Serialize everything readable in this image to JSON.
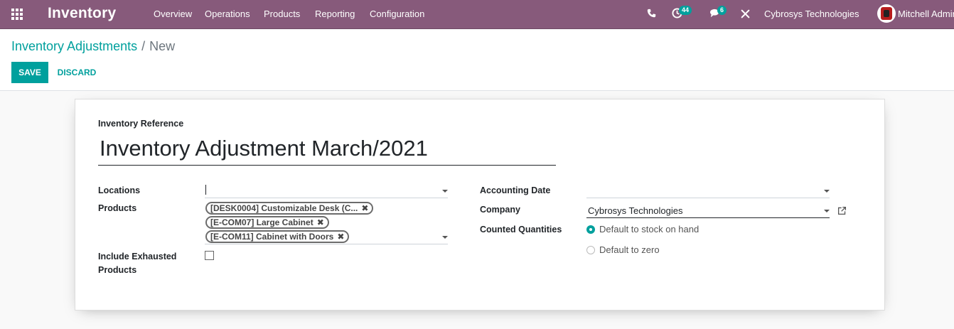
{
  "navbar": {
    "app_title": "Inventory",
    "menu": [
      "Overview",
      "Operations",
      "Products",
      "Reporting",
      "Configuration"
    ],
    "activity_count": "44",
    "message_count": "6",
    "company": "Cybrosys Technologies",
    "user": "Mitchell Admin",
    "bg_color": "#875a7b"
  },
  "breadcrumb": {
    "parent": "Inventory Adjustments",
    "separator": "/",
    "current": "New"
  },
  "toolbar": {
    "save_label": "SAVE",
    "discard_label": "DISCARD",
    "accent_color": "#00a09d"
  },
  "form": {
    "ref_label": "Inventory Reference",
    "ref_value": "Inventory Adjustment March/2021",
    "locations_label": "Locations",
    "locations_value": "",
    "products_label": "Products",
    "product_tags": [
      "[DESK0004] Customizable Desk (C...",
      "[E-COM07] Large Cabinet",
      "[E-COM11] Cabinet with Doors"
    ],
    "exhausted_label": "Include Exhausted Products",
    "exhausted_checked": false,
    "accounting_date_label": "Accounting Date",
    "accounting_date_value": "",
    "company_label": "Company",
    "company_value": "Cybrosys Technologies",
    "counted_label": "Counted Quantities",
    "counted_options": [
      "Default to stock on hand",
      "Default to zero"
    ],
    "counted_selected": 0
  }
}
